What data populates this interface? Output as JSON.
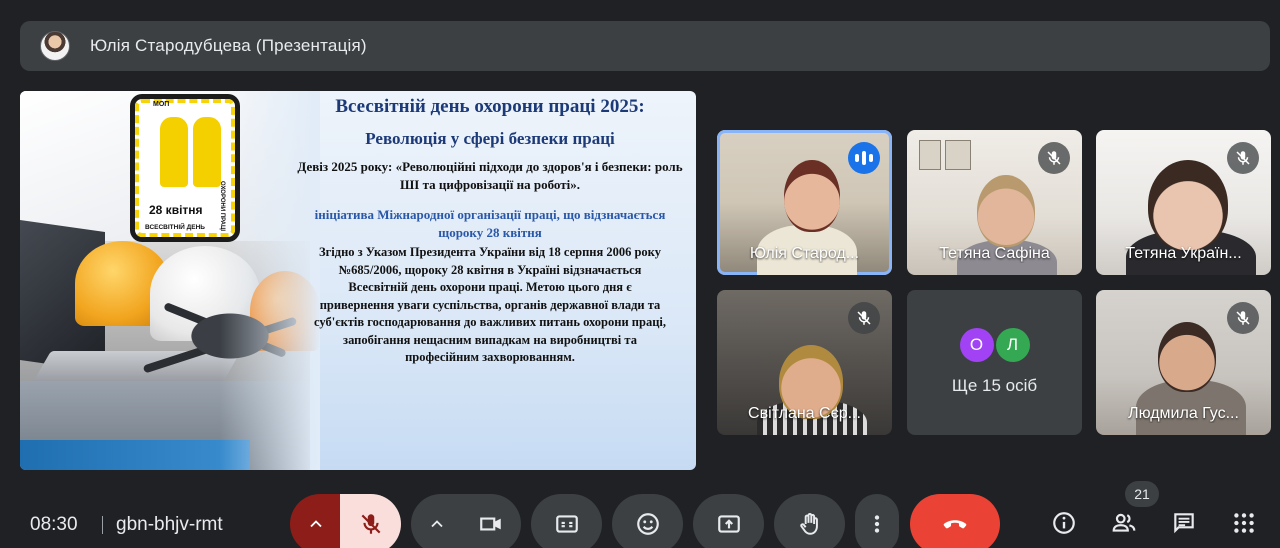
{
  "presenter": {
    "name": "Юлія Стародубцева (Презентація)",
    "avatar_icon": "presenter-avatar"
  },
  "slide": {
    "poster": {
      "top_label": "МОП",
      "days": "28 квітня",
      "side_text": "ОХОРОНИ ПРАЦІ",
      "bottom_text": "ВСЕСВІТНІЙ ДЕНЬ"
    },
    "title": "Всесвітній день охорони праці 2025:",
    "subtitle": "Революція у сфері безпеки праці",
    "motto": "Девіз 2025 року: «Революційні підходи до здоров'я і безпеки: роль ШІ та цифровізації на роботі».",
    "initiative": "ініціатива Міжнародної організації праці, що відзначається щороку 28 квітня",
    "body": "Згідно з Указом Президента України від 18 серпня 2006 року №685/2006, щороку 28 квітня в Україні відзначається Всесвітній день охорони праці. Метою цього дня є привернення уваги суспільства, органів державної влади та суб'єктів господарювання до важливих питань охорони праці, запобігання нещасним випадкам на виробництві та професійним захворюванням."
  },
  "participants": [
    {
      "name": "Юлія Стародубцева",
      "display": "Юлія Старод...",
      "state": "speaking",
      "active": true
    },
    {
      "name": "Тетяна Сафіна",
      "display": "Тетяна Сафіна",
      "state": "muted"
    },
    {
      "name": "Тетяна Українець",
      "display": "Тетяна Україн...",
      "state": "muted"
    },
    {
      "name": "Світлана Сєрова",
      "display": "Світлана Сєр...",
      "state": "muted"
    },
    {
      "name": "Людмила Гусєва",
      "display": "Людмила Гус...",
      "state": "muted"
    }
  ],
  "more": {
    "avatars": [
      {
        "letter": "О",
        "color": "#a142f4"
      },
      {
        "letter": "Л",
        "color": "#34a853"
      }
    ],
    "label": "Ще 15 осіб"
  },
  "bottom_bar": {
    "time": "08:30",
    "meeting_code": "gbn-bhjv-rmt",
    "participant_count": "21",
    "colors": {
      "mic_off_bg": "#f9dedc",
      "mic_off_split": "#8c1d18",
      "end_call": "#ea4335"
    }
  }
}
